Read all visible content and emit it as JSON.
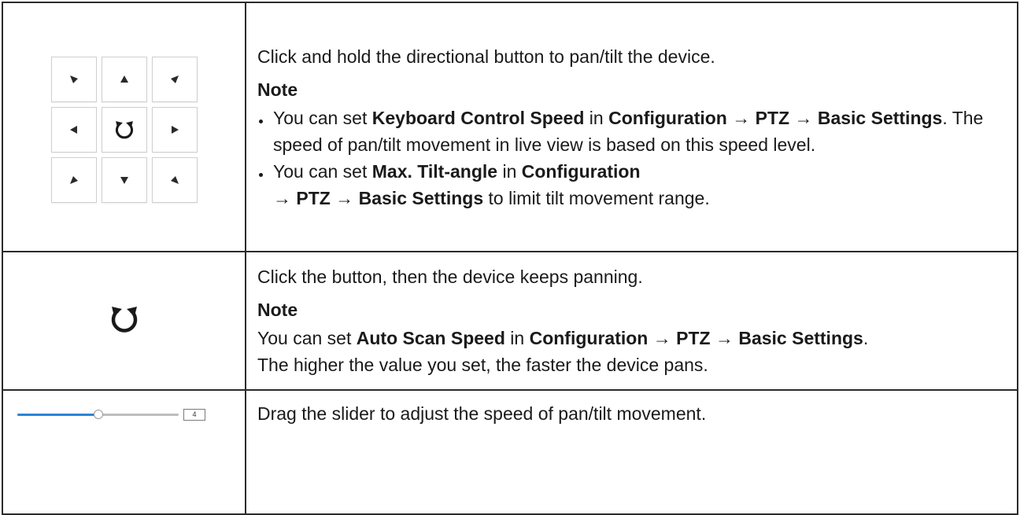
{
  "rows": [
    {
      "icon": "ptz-direction-grid-icon",
      "description": "Click and hold the directional button to pan/tilt the device.",
      "note_heading": "Note",
      "note_items": [
        {
          "parts": [
            {
              "t": "You can set ",
              "b": false
            },
            {
              "t": "Keyboard Control Speed",
              "b": true
            },
            {
              "t": " in ",
              "b": false
            },
            {
              "t": "Configuration → PTZ → Basic Settings",
              "b": true
            },
            {
              "t": ". The speed of pan/tilt movement in live view is based on this speed level.",
              "b": false
            }
          ]
        },
        {
          "parts": [
            {
              "t": "You can set ",
              "b": false
            },
            {
              "t": "Max. Tilt-angle",
              "b": true
            },
            {
              "t": " in ",
              "b": false
            },
            {
              "t": "Configuration",
              "b": true
            },
            {
              "t": "\n",
              "b": false
            },
            {
              "t": "→ PTZ → Basic Settings",
              "b": true
            },
            {
              "t": " to limit tilt movement range.",
              "b": false
            }
          ]
        }
      ]
    },
    {
      "icon": "auto-scan-icon",
      "description": "Click the button, then the device keeps panning.",
      "note_heading": "Note",
      "note_parts": [
        {
          "t": "You can set ",
          "b": false
        },
        {
          "t": "Auto Scan Speed",
          "b": true
        },
        {
          "t": " in ",
          "b": false
        },
        {
          "t": "Configuration → PTZ → Basic Settings",
          "b": true
        },
        {
          "t": ".",
          "b": false
        },
        {
          "t": "\n",
          "b": false
        },
        {
          "t": "The higher the value you set, the faster the device pans.",
          "b": false
        }
      ]
    },
    {
      "icon": "speed-slider-icon",
      "description": "Drag the slider to adjust the speed of pan/tilt movement.",
      "slider": {
        "value": "4",
        "min": 1,
        "max": 7,
        "fill_color": "#2a84d8"
      }
    }
  ],
  "ptz_buttons": [
    {
      "name": "up-left",
      "glyph": "arrow-down-right"
    },
    {
      "name": "up",
      "glyph": "arrow-up"
    },
    {
      "name": "up-right",
      "glyph": "arrow-down-left"
    },
    {
      "name": "left",
      "glyph": "arrow-left"
    },
    {
      "name": "auto-scan",
      "glyph": "rotate"
    },
    {
      "name": "right",
      "glyph": "arrow-right"
    },
    {
      "name": "down-left",
      "glyph": "arrow-up-right"
    },
    {
      "name": "down",
      "glyph": "arrow-down"
    },
    {
      "name": "down-right",
      "glyph": "arrow-up-left"
    }
  ]
}
